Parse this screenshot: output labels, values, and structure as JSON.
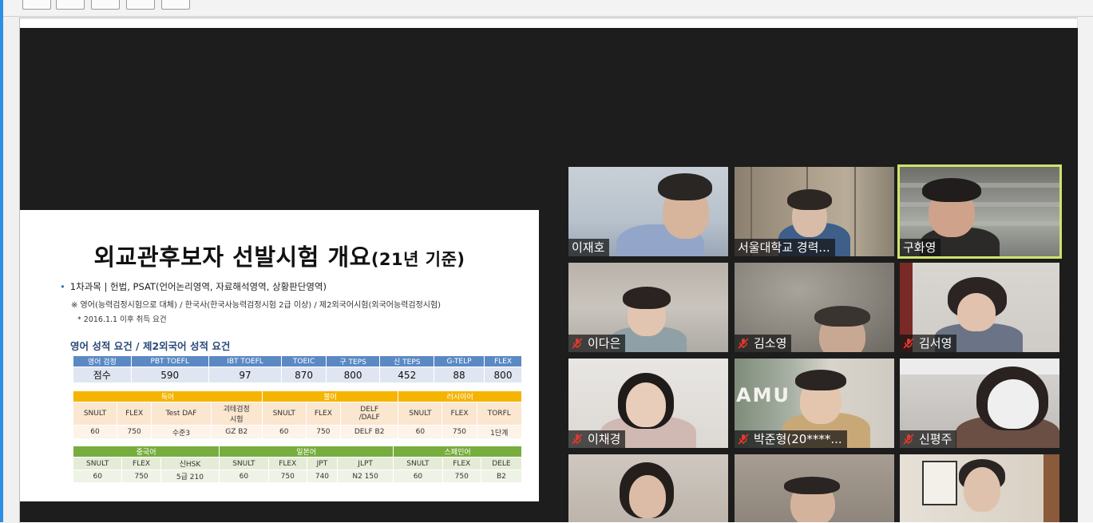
{
  "slide": {
    "title_main": "외교관후보자 선발시험 개요",
    "title_paren": "(21년 기준)",
    "bullet1": "1차과목 | 헌법, PSAT(언어논리영역, 자료해석영역, 상황판단영역)",
    "bullet2": "※ 영어(능력검정시험으로 대체) / 한국사(한국사능력검정시험 2급 이상) / 제2외국어시험(외국어능력검정시험)",
    "bullet3": "* 2016.1.1 이후 취득 요건",
    "section_title": "영어 성적 요건 / 제2외국어 성적 요건",
    "english_table": {
      "headers": [
        "영어 검정",
        "PBT TOEFL",
        "IBT TOEFL",
        "TOEIC",
        "구 TEPS",
        "신 TEPS",
        "G-TELP",
        "FLEX"
      ],
      "row": [
        "점수",
        "590",
        "97",
        "870",
        "800",
        "452",
        "88",
        "800"
      ]
    },
    "lang_table1": {
      "groups": [
        "독어",
        "불어",
        "러시아어"
      ],
      "names": [
        "SNULT",
        "FLEX",
        "Test DAF",
        "괴테검정\n시험",
        "SNULT",
        "FLEX",
        "DELF\n/DALF",
        "SNULT",
        "FLEX",
        "TORFL"
      ],
      "values": [
        "60",
        "750",
        "수준3",
        "GZ B2",
        "60",
        "750",
        "DELF B2",
        "60",
        "750",
        "1단계"
      ]
    },
    "lang_table2": {
      "groups": [
        "중국어",
        "일본어",
        "스페인어"
      ],
      "names": [
        "SNULT",
        "FLEX",
        "신HSK",
        "SNULT",
        "FLEX",
        "JPT",
        "JLPT",
        "SNULT",
        "FLEX",
        "DELE"
      ],
      "values": [
        "60",
        "750",
        "5급 210",
        "60",
        "750",
        "740",
        "N2 150",
        "60",
        "750",
        "B2"
      ]
    }
  },
  "participants": [
    {
      "name": "이재호",
      "muted": false,
      "active": false
    },
    {
      "name": "서울대학교 경력...",
      "muted": false,
      "active": false
    },
    {
      "name": "구화영",
      "muted": false,
      "active": true
    },
    {
      "name": "이다은",
      "muted": true,
      "active": false
    },
    {
      "name": "김소영",
      "muted": true,
      "active": false
    },
    {
      "name": "김서영",
      "muted": true,
      "active": false
    },
    {
      "name": "이채경",
      "muted": true,
      "active": false
    },
    {
      "name": "박준형(20****...",
      "muted": true,
      "active": false
    },
    {
      "name": "신평주",
      "muted": true,
      "active": false
    }
  ],
  "background_sign_text": "AMU",
  "colors": {
    "meeting_bg": "#1d1d1d",
    "active_speaker_border": "#cfe46a",
    "mute_icon": "#e0392b",
    "english_table_header": "#5b89c4",
    "german_group_header": "#f5b400",
    "chinese_group_header": "#77ad3e"
  }
}
